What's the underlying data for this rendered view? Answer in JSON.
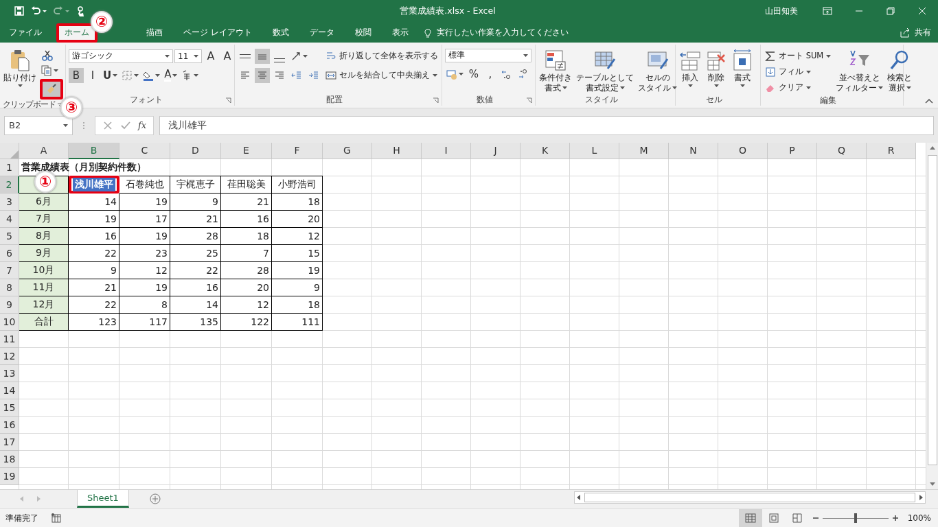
{
  "window": {
    "title": "営業成績表.xlsx  -  Excel",
    "user": "山田知美"
  },
  "ribbon_tabs": [
    {
      "label": "ファイル",
      "selected": false,
      "marked": false
    },
    {
      "label": "ホーム",
      "selected": true,
      "marked": true
    },
    {
      "label": "描画",
      "selected": false,
      "marked": false
    },
    {
      "label": "ページ レイアウト",
      "selected": false,
      "marked": false
    },
    {
      "label": "数式",
      "selected": false,
      "marked": false
    },
    {
      "label": "データ",
      "selected": false,
      "marked": false
    },
    {
      "label": "校閲",
      "selected": false,
      "marked": false
    },
    {
      "label": "表示",
      "selected": false,
      "marked": false
    }
  ],
  "tell_me": {
    "placeholder": "実行したい作業を入力してください"
  },
  "share": "共有",
  "ribbon_groups": [
    {
      "label": "クリップボード",
      "launcher": true,
      "columns": [
        [
          [
            {
              "kind": "large",
              "lines": [
                "貼り付け"
              ],
              "dropdown": true
            }
          ]
        ],
        [
          [
            {
              "kind": "tool",
              "dropdown": false
            }
          ],
          [
            {
              "kind": "tool",
              "dropdown": true
            }
          ],
          [
            {
              "kind": "tool",
              "dropdown": false,
              "selected": true,
              "marked": true
            }
          ]
        ]
      ]
    },
    {
      "label": "フォント",
      "launcher": true,
      "columns": [
        [
          [
            {
              "kind": "field",
              "value": "游ゴシック"
            },
            {
              "kind": "field",
              "value": "11"
            },
            {
              "kind": "tool",
              "label": "A",
              "dropdown": false
            },
            {
              "kind": "tool",
              "label": "A",
              "dropdown": false
            }
          ],
          [
            {
              "kind": "tool",
              "label": "B",
              "dropdown": false,
              "selected": true
            },
            {
              "kind": "tool",
              "label": "I",
              "dropdown": false,
              "selected": false
            },
            {
              "kind": "tool",
              "label": "U",
              "dropdown": true,
              "selected": false
            },
            {
              "kind": "tool",
              "dropdown": true
            },
            {
              "kind": "tool",
              "dropdown": true
            },
            {
              "kind": "tool",
              "label": "A",
              "dropdown": true
            },
            {
              "kind": "tool",
              "dropdown": true
            }
          ]
        ]
      ]
    },
    {
      "label": "配置",
      "launcher": true,
      "columns": [
        [
          [
            {
              "kind": "tool",
              "selected": false
            },
            {
              "kind": "tool",
              "selected": true
            },
            {
              "kind": "tool",
              "selected": false
            },
            {
              "kind": "tool",
              "dropdown": true
            }
          ],
          [
            {
              "kind": "tool",
              "selected": false
            },
            {
              "kind": "tool",
              "selected": true
            },
            {
              "kind": "tool",
              "selected": false
            },
            {
              "kind": "tool"
            },
            {
              "kind": "tool"
            }
          ]
        ],
        [
          [
            {
              "kind": "small",
              "label": "折り返して全体を表示する",
              "dropdown": false
            }
          ],
          [
            {
              "kind": "small",
              "label": "セルを結合して中央揃え",
              "dropdown": true
            }
          ]
        ]
      ]
    },
    {
      "label": "数値",
      "launcher": true,
      "columns": [
        [
          [
            {
              "kind": "field",
              "value": "標準"
            }
          ],
          [
            {
              "kind": "tool",
              "dropdown": true
            },
            {
              "kind": "tool",
              "label": "%"
            },
            {
              "kind": "tool",
              "label": ","
            },
            {
              "kind": "tool"
            },
            {
              "kind": "tool"
            }
          ]
        ]
      ]
    },
    {
      "label": "スタイル",
      "launcher": false,
      "columns": [
        [
          [
            {
              "kind": "large",
              "lines": [
                "条件付き",
                "書式"
              ],
              "dropdown": true
            }
          ]
        ],
        [
          [
            {
              "kind": "large",
              "lines": [
                "テーブルとして",
                "書式設定"
              ],
              "dropdown": true
            }
          ]
        ],
        [
          [
            {
              "kind": "large",
              "lines": [
                "セルの",
                "スタイル"
              ],
              "dropdown": true
            }
          ]
        ]
      ]
    },
    {
      "label": "セル",
      "launcher": false,
      "columns": [
        [
          [
            {
              "kind": "large",
              "lines": [
                "挿入"
              ],
              "dropdown": true
            }
          ]
        ],
        [
          [
            {
              "kind": "large",
              "lines": [
                "削除"
              ],
              "dropdown": true
            }
          ]
        ],
        [
          [
            {
              "kind": "large",
              "lines": [
                "書式"
              ],
              "dropdown": true
            }
          ]
        ]
      ]
    },
    {
      "label": "編集",
      "launcher": false,
      "columns": [
        [
          [
            {
              "kind": "small",
              "label": "オート SUM",
              "dropdown": true
            }
          ],
          [
            {
              "kind": "small",
              "label": "フィル",
              "dropdown": true
            }
          ],
          [
            {
              "kind": "small",
              "label": "クリア",
              "dropdown": true
            }
          ]
        ],
        [
          [
            {
              "kind": "large",
              "lines": [
                "並べ替えと",
                "フィルター"
              ],
              "dropdown": true
            }
          ]
        ],
        [
          [
            {
              "kind": "large",
              "lines": [
                "検索と",
                "選択"
              ],
              "dropdown": true
            }
          ]
        ]
      ]
    }
  ],
  "formula_bar": {
    "name_box": "B2",
    "function_label": "fx",
    "formula": "浅川雄平"
  },
  "columns": [
    {
      "label": "A",
      "selected": false
    },
    {
      "label": "B",
      "selected": true
    },
    {
      "label": "C",
      "selected": false
    },
    {
      "label": "D",
      "selected": false
    },
    {
      "label": "E",
      "selected": false
    },
    {
      "label": "F",
      "selected": false
    },
    {
      "label": "G",
      "selected": false
    },
    {
      "label": "H",
      "selected": false
    },
    {
      "label": "I",
      "selected": false
    },
    {
      "label": "J",
      "selected": false
    },
    {
      "label": "K",
      "selected": false
    },
    {
      "label": "L",
      "selected": false
    },
    {
      "label": "M",
      "selected": false
    },
    {
      "label": "N",
      "selected": false
    },
    {
      "label": "O",
      "selected": false
    },
    {
      "label": "P",
      "selected": false
    },
    {
      "label": "Q",
      "selected": false
    },
    {
      "label": "R",
      "selected": false
    }
  ],
  "row_numbers": [
    {
      "label": "1",
      "selected": false
    },
    {
      "label": "2",
      "selected": true
    },
    {
      "label": "3",
      "selected": false
    },
    {
      "label": "4",
      "selected": false
    },
    {
      "label": "5",
      "selected": false
    },
    {
      "label": "6",
      "selected": false
    },
    {
      "label": "7",
      "selected": false
    },
    {
      "label": "8",
      "selected": false
    },
    {
      "label": "9",
      "selected": false
    },
    {
      "label": "10",
      "selected": false
    },
    {
      "label": "11",
      "selected": false
    },
    {
      "label": "12",
      "selected": false
    },
    {
      "label": "13",
      "selected": false
    },
    {
      "label": "14",
      "selected": false
    },
    {
      "label": "15",
      "selected": false
    },
    {
      "label": "16",
      "selected": false
    },
    {
      "label": "17",
      "selected": false
    },
    {
      "label": "18",
      "selected": false
    },
    {
      "label": "19",
      "selected": false
    }
  ],
  "sheet_title": "営業成績表（月別契約件数）",
  "table": {
    "headers": [
      {
        "text": "浅川雄平",
        "selected": true,
        "marked": true
      },
      {
        "text": "石巻純也",
        "selected": false,
        "marked": false
      },
      {
        "text": "宇梶恵子",
        "selected": false,
        "marked": false
      },
      {
        "text": "荏田聡美",
        "selected": false,
        "marked": false
      },
      {
        "text": "小野浩司",
        "selected": false,
        "marked": false
      }
    ],
    "rows": [
      {
        "label": "6月",
        "values": [
          "14",
          "19",
          "9",
          "21",
          "18"
        ]
      },
      {
        "label": "7月",
        "values": [
          "19",
          "17",
          "21",
          "16",
          "20"
        ]
      },
      {
        "label": "8月",
        "values": [
          "16",
          "19",
          "28",
          "18",
          "12"
        ]
      },
      {
        "label": "9月",
        "values": [
          "22",
          "23",
          "25",
          "7",
          "15"
        ]
      },
      {
        "label": "10月",
        "values": [
          "9",
          "12",
          "22",
          "28",
          "19"
        ]
      },
      {
        "label": "11月",
        "values": [
          "21",
          "19",
          "16",
          "20",
          "9"
        ]
      },
      {
        "label": "12月",
        "values": [
          "22",
          "8",
          "14",
          "12",
          "18"
        ]
      },
      {
        "label": "合計",
        "values": [
          "123",
          "117",
          "135",
          "122",
          "111"
        ]
      }
    ]
  },
  "sheet_tabs": [
    {
      "label": "Sheet1",
      "selected": true
    }
  ],
  "status_bar": {
    "status": "準備完了",
    "views": [
      {
        "selected": true
      },
      {
        "selected": false
      },
      {
        "selected": false
      }
    ],
    "zoom": {
      "level": 0.5,
      "reading": "100%"
    }
  },
  "callouts": [
    {
      "label": "①"
    },
    {
      "label": "②"
    },
    {
      "label": "③"
    }
  ]
}
